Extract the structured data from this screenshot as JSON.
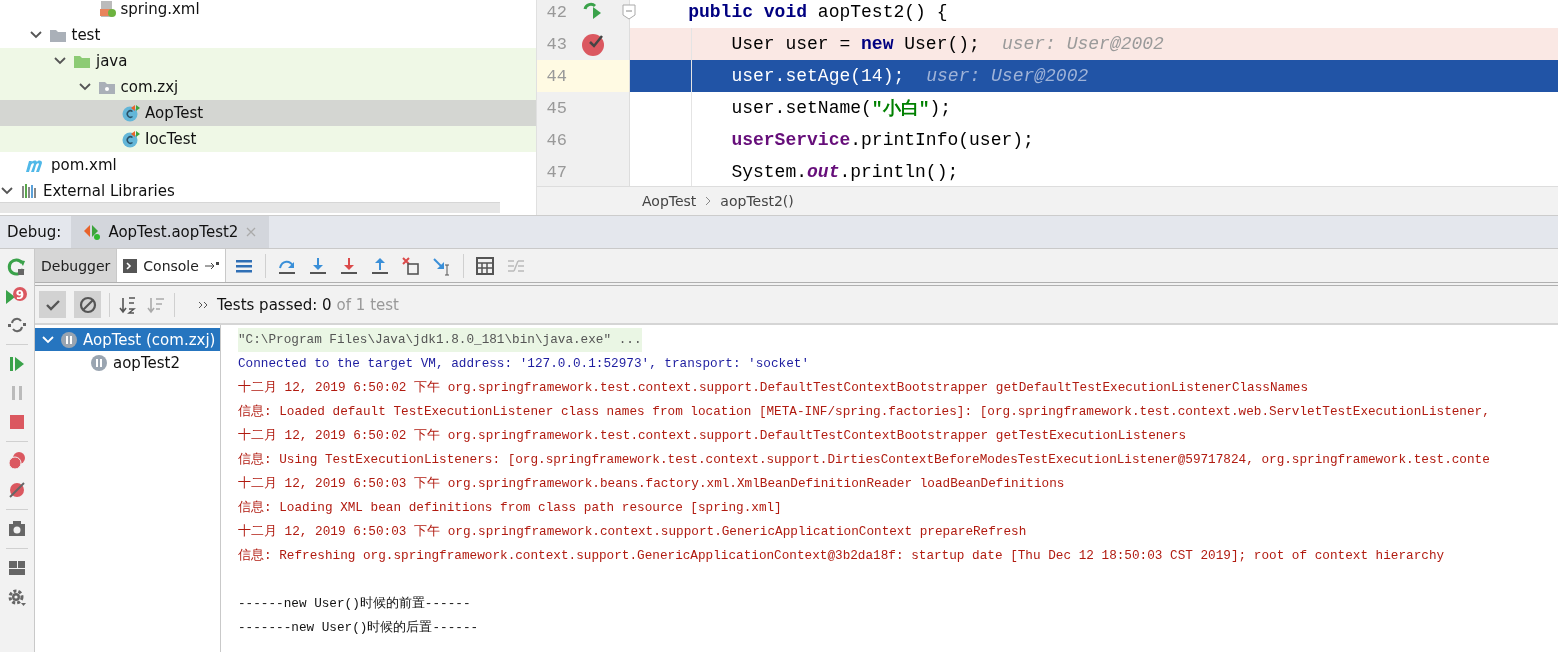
{
  "project_tree": [
    {
      "children": [
        {
          "children": [
            {
              "children": [
                {
                  "children": [
                    {
                      "label": "spring.xml",
                      "kind": "spring-xml",
                      "selected": false,
                      "test_scope": false
                    }
                  ]
                }
              ]
            },
            {
              "label": "test",
              "kind": "folder",
              "expanded": true,
              "selected": false,
              "test_scope": false,
              "children": [
                {
                  "label": "java",
                  "kind": "test-root",
                  "expanded": true,
                  "selected": false,
                  "test_scope": true,
                  "children": [
                    {
                      "label": "com.zxj",
                      "kind": "package",
                      "expanded": true,
                      "selected": false,
                      "test_scope": true,
                      "children": [
                        {
                          "label": "AopTest",
                          "kind": "test-class",
                          "selected": true,
                          "test_scope": true
                        },
                        {
                          "label": "IocTest",
                          "kind": "test-class",
                          "selected": false,
                          "test_scope": true
                        }
                      ]
                    }
                  ]
                }
              ]
            }
          ]
        },
        {
          "label": "pom.xml",
          "kind": "maven",
          "selected": false,
          "test_scope": false
        }
      ]
    },
    {
      "label": "External Libraries",
      "kind": "libraries",
      "expanded": true,
      "selected": false,
      "test_scope": false
    }
  ],
  "editor": {
    "lines": [
      {
        "number": "42",
        "runnable": true,
        "breakpoint": false,
        "current": false,
        "segments": [
          {
            "text": "    public void",
            "kind": "keyword"
          },
          {
            "text": " aopTest2() {",
            "kind": "plain"
          }
        ]
      },
      {
        "number": "43",
        "runnable": false,
        "breakpoint": true,
        "current": false,
        "hint": "user: User@2002",
        "segments": [
          {
            "text": "        User user = ",
            "kind": "plain"
          },
          {
            "text": "new",
            "kind": "keyword"
          },
          {
            "text": " User();",
            "kind": "plain"
          }
        ]
      },
      {
        "number": "44",
        "runnable": false,
        "breakpoint": false,
        "current": true,
        "hint": "user: User@2002",
        "segments": [
          {
            "text": "        user.setAge(14);",
            "kind": "plain"
          }
        ]
      },
      {
        "number": "45",
        "runnable": false,
        "breakpoint": false,
        "current": false,
        "segments": [
          {
            "text": "        user.setName(",
            "kind": "plain"
          },
          {
            "text": "\"小白\"",
            "kind": "string"
          },
          {
            "text": ");",
            "kind": "plain"
          }
        ]
      },
      {
        "number": "46",
        "runnable": false,
        "breakpoint": false,
        "current": false,
        "segments": [
          {
            "text": "        userService",
            "kind": "field"
          },
          {
            "text": ".printInfo(user);",
            "kind": "plain"
          }
        ]
      },
      {
        "number": "47",
        "runnable": false,
        "breakpoint": false,
        "current": false,
        "segments": [
          {
            "text": "        System.",
            "kind": "plain"
          },
          {
            "text": "out",
            "kind": "static"
          },
          {
            "text": ".println();",
            "kind": "plain"
          }
        ]
      }
    ],
    "breadcrumbs": [
      "AopTest",
      "aopTest2()"
    ]
  },
  "debug_bar": {
    "label": "Debug:",
    "tabs": [
      {
        "label": "AopTest.aopTest2",
        "selected": true
      }
    ]
  },
  "side_toolbar": {
    "badge": "9"
  },
  "panel_tabs": [
    {
      "label": "Debugger",
      "selected": false
    },
    {
      "label": "Console",
      "selected": true
    }
  ],
  "test_toolbar": {
    "show_passed": true,
    "show_ignored": true,
    "passed": "Tests passed: 0",
    "total": "of 1 test"
  },
  "test_tree": [
    {
      "label": "AopTest (com.zxj)",
      "selected": true,
      "expanded": true,
      "children": [
        {
          "label": "aopTest2",
          "selected": false
        }
      ]
    }
  ],
  "console": [
    {
      "kind": "command",
      "text": "\"C:\\Program Files\\Java\\jdk1.8.0_181\\bin\\java.exe\" ..."
    },
    {
      "kind": "system",
      "text": "Connected to the target VM, address: '127.0.0.1:52973', transport: 'socket'"
    },
    {
      "kind": "error",
      "text": "十二月 12, 2019 6:50:02 下午 org.springframework.test.context.support.DefaultTestContextBootstrapper getDefaultTestExecutionListenerClassNames"
    },
    {
      "kind": "error",
      "text": "信息: Loaded default TestExecutionListener class names from location [META-INF/spring.factories]: [org.springframework.test.context.web.ServletTestExecutionListener,"
    },
    {
      "kind": "error",
      "text": "十二月 12, 2019 6:50:02 下午 org.springframework.test.context.support.DefaultTestContextBootstrapper getTestExecutionListeners"
    },
    {
      "kind": "error",
      "text": "信息: Using TestExecutionListeners: [org.springframework.test.context.support.DirtiesContextBeforeModesTestExecutionListener@59717824, org.springframework.test.conte"
    },
    {
      "kind": "error",
      "text": "十二月 12, 2019 6:50:03 下午 org.springframework.beans.factory.xml.XmlBeanDefinitionReader loadBeanDefinitions"
    },
    {
      "kind": "error",
      "text": "信息: Loading XML bean definitions from class path resource [spring.xml]"
    },
    {
      "kind": "error",
      "text": "十二月 12, 2019 6:50:03 下午 org.springframework.context.support.GenericApplicationContext prepareRefresh"
    },
    {
      "kind": "error",
      "text": "信息: Refreshing org.springframework.context.support.GenericApplicationContext@3b2da18f: startup date [Thu Dec 12 18:50:03 CST 2019]; root of context hierarchy"
    },
    {
      "kind": "blank"
    },
    {
      "kind": "output",
      "text": "------new User()时候的前置------"
    },
    {
      "kind": "output",
      "text": "-------new User()时候的后置------"
    }
  ]
}
